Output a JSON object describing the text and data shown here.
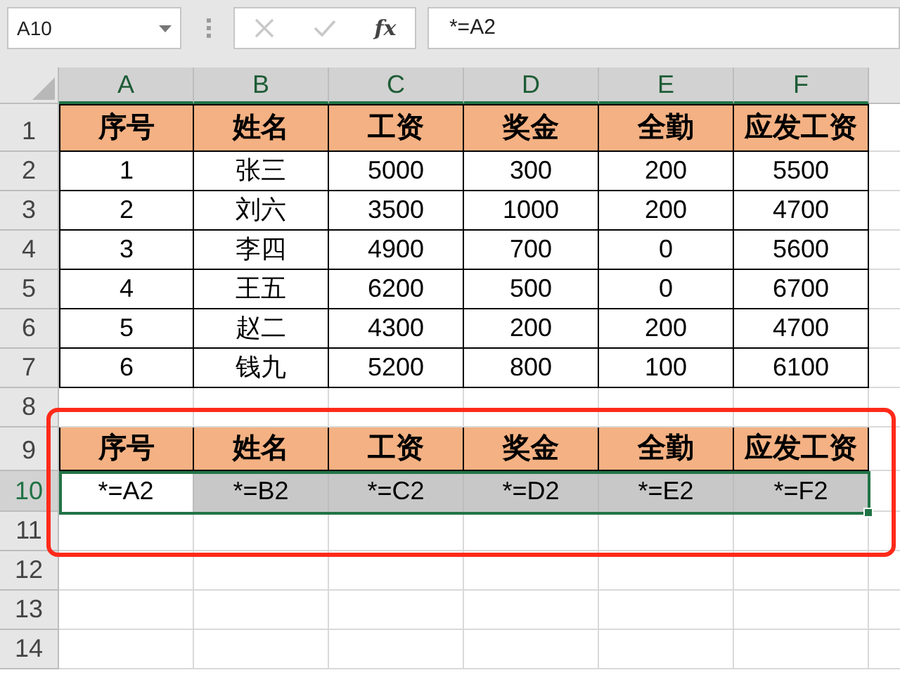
{
  "name_box": {
    "value": "A10"
  },
  "formula_bar": {
    "cancel_disabled": true,
    "enter_disabled": true,
    "fx": "fx",
    "value": "*=A2"
  },
  "columns": [
    {
      "label": "A",
      "selected": true
    },
    {
      "label": "B",
      "selected": true
    },
    {
      "label": "C",
      "selected": true
    },
    {
      "label": "D",
      "selected": true
    },
    {
      "label": "E",
      "selected": true
    },
    {
      "label": "F",
      "selected": true
    }
  ],
  "rows": [
    {
      "number": "1",
      "selected": false,
      "kind": "header",
      "cells": [
        "序号",
        "姓名",
        "工资",
        "奖金",
        "全勤",
        "应发工资"
      ]
    },
    {
      "number": "2",
      "selected": false,
      "kind": "data",
      "cells": [
        "1",
        "张三",
        "5000",
        "300",
        "200",
        "5500"
      ]
    },
    {
      "number": "3",
      "selected": false,
      "kind": "data",
      "cells": [
        "2",
        "刘六",
        "3500",
        "1000",
        "200",
        "4700"
      ]
    },
    {
      "number": "4",
      "selected": false,
      "kind": "data",
      "cells": [
        "3",
        "李四",
        "4900",
        "700",
        "0",
        "5600"
      ]
    },
    {
      "number": "5",
      "selected": false,
      "kind": "data",
      "cells": [
        "4",
        "王五",
        "6200",
        "500",
        "0",
        "6700"
      ]
    },
    {
      "number": "6",
      "selected": false,
      "kind": "data",
      "cells": [
        "5",
        "赵二",
        "4300",
        "200",
        "200",
        "4700"
      ]
    },
    {
      "number": "7",
      "selected": false,
      "kind": "data",
      "cells": [
        "6",
        "钱九",
        "5200",
        "800",
        "100",
        "6100"
      ]
    },
    {
      "number": "8",
      "selected": false,
      "kind": "empty"
    },
    {
      "number": "9",
      "selected": false,
      "kind": "header",
      "cells": [
        "序号",
        "姓名",
        "工资",
        "奖金",
        "全勤",
        "应发工资"
      ]
    },
    {
      "number": "10",
      "selected": true,
      "kind": "range",
      "cells": [
        {
          "text": "*=A2",
          "active": true
        },
        {
          "text": "*=B2",
          "active": false
        },
        {
          "text": "*=C2",
          "active": false
        },
        {
          "text": "*=D2",
          "active": false
        },
        {
          "text": "*=E2",
          "active": false
        },
        {
          "text": "*=F2",
          "active": false
        }
      ]
    },
    {
      "number": "11",
      "selected": false,
      "kind": "empty"
    },
    {
      "number": "12",
      "selected": false,
      "kind": "empty"
    },
    {
      "number": "13",
      "selected": false,
      "kind": "empty"
    },
    {
      "number": "14",
      "selected": false,
      "kind": "empty"
    }
  ]
}
